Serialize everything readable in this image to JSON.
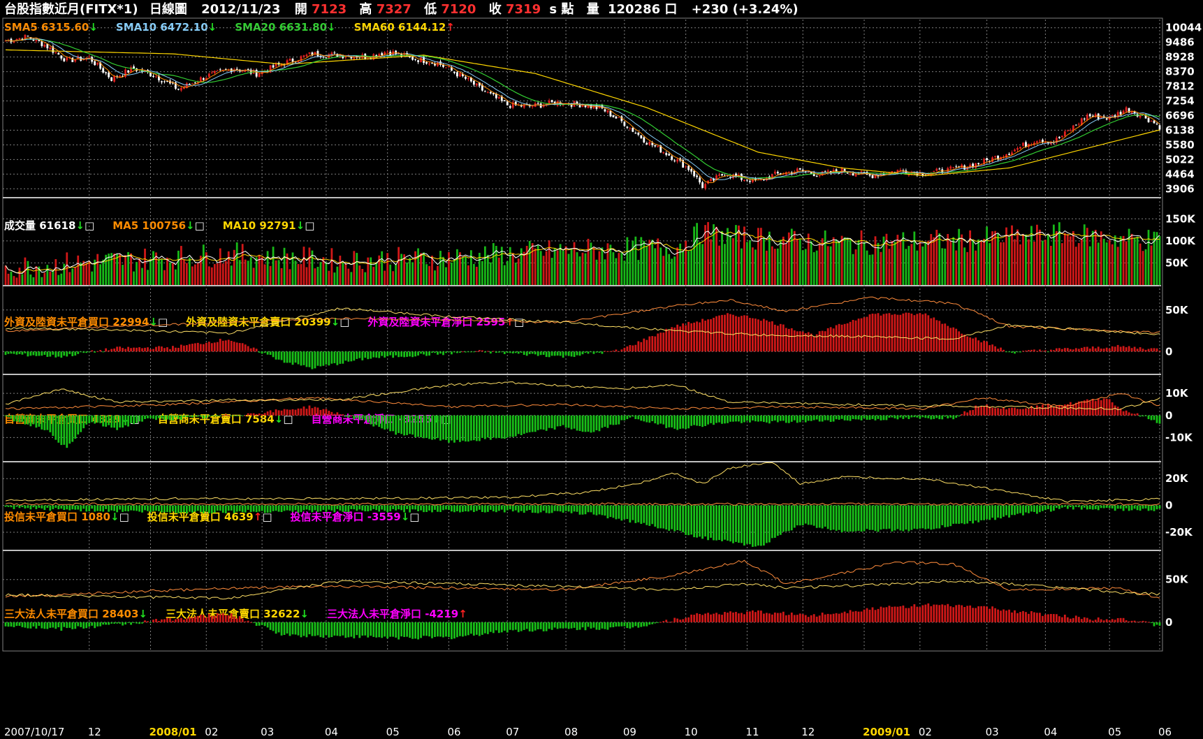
{
  "header": {
    "title": "台股指數近月(FITX*1)",
    "period": "日線圖",
    "date": "2012/11/23",
    "open_label": "開",
    "open": "7123",
    "high_label": "高",
    "high": "7327",
    "low_label": "低",
    "low": "7120",
    "close_label": "收",
    "close": "7319",
    "unit": "s 點",
    "volume_label": "量",
    "volume": "120286 口",
    "change": "+230 (+3.24%)"
  },
  "colors": {
    "up": "#e02020",
    "down": "#20c020",
    "grid": "#808080",
    "sma5": "#ff8c00",
    "sma10": "#87cefa",
    "sma20": "#32cd32",
    "sma60": "#ffd700",
    "magenta": "#ff00ff"
  },
  "chart_data": [
    {
      "type": "candlestick",
      "panel": "price",
      "legend": [
        {
          "label": "SMA5",
          "value": "6315.60",
          "arrow": "down",
          "color": "#ff8c00"
        },
        {
          "label": "SMA10",
          "value": "6472.10",
          "arrow": "down",
          "color": "#87cefa"
        },
        {
          "label": "SMA20",
          "value": "6631.80",
          "arrow": "down",
          "color": "#32cd32"
        },
        {
          "label": "SMA60",
          "value": "6144.12",
          "arrow": "up",
          "color": "#ffd700"
        }
      ],
      "ylim": [
        3700,
        10250
      ],
      "yticks": [
        "10044",
        "9486",
        "8928",
        "8370",
        "7812",
        "7254",
        "6696",
        "6138",
        "5580",
        "5022",
        "4464",
        "3906"
      ],
      "close_keypoints": [
        [
          0,
          9550
        ],
        [
          8,
          9700
        ],
        [
          14,
          9400
        ],
        [
          22,
          8800
        ],
        [
          30,
          8900
        ],
        [
          38,
          8100
        ],
        [
          46,
          8500
        ],
        [
          54,
          8200
        ],
        [
          62,
          7700
        ],
        [
          72,
          8200
        ],
        [
          82,
          8500
        ],
        [
          90,
          8300
        ],
        [
          100,
          8700
        ],
        [
          110,
          9050
        ],
        [
          120,
          9000
        ],
        [
          130,
          8950
        ],
        [
          137,
          9150
        ],
        [
          145,
          8900
        ],
        [
          155,
          8700
        ],
        [
          165,
          8100
        ],
        [
          172,
          7600
        ],
        [
          180,
          7100
        ],
        [
          188,
          7050
        ],
        [
          198,
          7200
        ],
        [
          208,
          7100
        ],
        [
          214,
          6950
        ],
        [
          222,
          6400
        ],
        [
          230,
          5700
        ],
        [
          238,
          5200
        ],
        [
          246,
          4600
        ],
        [
          250,
          4000
        ],
        [
          258,
          4500
        ],
        [
          264,
          4300
        ],
        [
          270,
          4200
        ],
        [
          276,
          4450
        ],
        [
          284,
          4600
        ],
        [
          292,
          4450
        ],
        [
          300,
          4600
        ],
        [
          310,
          4400
        ],
        [
          320,
          4600
        ],
        [
          330,
          4500
        ],
        [
          340,
          4650
        ],
        [
          350,
          4900
        ],
        [
          360,
          5300
        ],
        [
          370,
          5800
        ],
        [
          376,
          5700
        ],
        [
          380,
          6000
        ],
        [
          388,
          6700
        ],
        [
          396,
          6600
        ],
        [
          402,
          6950
        ],
        [
          408,
          6700
        ],
        [
          414,
          6280
        ]
      ],
      "sma60_keypoints": [
        [
          0,
          9200
        ],
        [
          60,
          9050
        ],
        [
          100,
          8650
        ],
        [
          150,
          9000
        ],
        [
          190,
          8300
        ],
        [
          230,
          7000
        ],
        [
          270,
          5300
        ],
        [
          300,
          4700
        ],
        [
          330,
          4400
        ],
        [
          360,
          4700
        ],
        [
          414,
          6150
        ]
      ],
      "xticks": [
        "2007/10/17",
        "12",
        "2008/01",
        "02",
        "03",
        "04",
        "05",
        "06",
        "07",
        "08",
        "09",
        "10",
        "11",
        "12",
        "2009/01",
        "02",
        "03",
        "04",
        "05",
        "06"
      ]
    },
    {
      "type": "bar",
      "panel": "volume",
      "legend": [
        {
          "label": "成交量",
          "value": "61618",
          "arrow": "down",
          "color": "#ffffff"
        },
        {
          "label": "MA5",
          "value": "100756",
          "arrow": "down",
          "color": "#ff8c00"
        },
        {
          "label": "MA10",
          "value": "92791",
          "arrow": "down",
          "color": "#ffd700"
        }
      ],
      "ylim": [
        0,
        190000
      ],
      "yticks": [
        "150K",
        "100K",
        "50K"
      ],
      "ytick_values": [
        150000,
        100000,
        50000
      ],
      "keypoints": [
        [
          0,
          40000
        ],
        [
          40,
          55000
        ],
        [
          80,
          70000
        ],
        [
          120,
          55000
        ],
        [
          160,
          62000
        ],
        [
          200,
          78000
        ],
        [
          240,
          85000
        ],
        [
          250,
          120000
        ],
        [
          260,
          110000
        ],
        [
          300,
          95000
        ],
        [
          340,
          100000
        ],
        [
          380,
          115000
        ],
        [
          414,
          100000
        ]
      ]
    },
    {
      "type": "bar+line",
      "panel": "foreign",
      "legend": [
        {
          "label": "外資及陸資未平倉買口",
          "value": "22994",
          "arrow": "down",
          "color": "#ff8c00"
        },
        {
          "label": "外資及陸資未平倉賣口",
          "value": "20399",
          "arrow": "down",
          "color": "#ffd700"
        },
        {
          "label": "外資及陸資未平倉淨口",
          "value": "2595",
          "arrow": "up",
          "color": "#ff00ff"
        }
      ],
      "ylim": [
        -25000,
        75000
      ],
      "yticks": [
        "50K",
        "0"
      ],
      "ytick_values": [
        50000,
        0
      ],
      "net_keypoints": [
        [
          0,
          -3000
        ],
        [
          20,
          -6000
        ],
        [
          40,
          4000
        ],
        [
          60,
          5000
        ],
        [
          80,
          15000
        ],
        [
          100,
          -12000
        ],
        [
          110,
          -20000
        ],
        [
          130,
          -8000
        ],
        [
          150,
          -4000
        ],
        [
          170,
          0
        ],
        [
          200,
          -6000
        ],
        [
          220,
          1000
        ],
        [
          240,
          30000
        ],
        [
          260,
          45000
        ],
        [
          270,
          40000
        ],
        [
          290,
          20000
        ],
        [
          310,
          45000
        ],
        [
          330,
          45000
        ],
        [
          345,
          20000
        ],
        [
          360,
          -1000
        ],
        [
          380,
          3000
        ],
        [
          400,
          6000
        ],
        [
          414,
          2595
        ]
      ],
      "buy_keypoints": [
        [
          0,
          25000
        ],
        [
          40,
          30000
        ],
        [
          80,
          35000
        ],
        [
          120,
          40000
        ],
        [
          160,
          38000
        ],
        [
          200,
          35000
        ],
        [
          240,
          55000
        ],
        [
          260,
          62000
        ],
        [
          280,
          48000
        ],
        [
          310,
          65000
        ],
        [
          340,
          58000
        ],
        [
          360,
          30000
        ],
        [
          414,
          23000
        ]
      ],
      "sell_keypoints": [
        [
          0,
          28000
        ],
        [
          40,
          26000
        ],
        [
          80,
          22000
        ],
        [
          120,
          52000
        ],
        [
          160,
          42000
        ],
        [
          200,
          35000
        ],
        [
          240,
          25000
        ],
        [
          270,
          20000
        ],
        [
          310,
          18000
        ],
        [
          340,
          15000
        ],
        [
          360,
          32000
        ],
        [
          414,
          20400
        ]
      ]
    },
    {
      "type": "bar+line",
      "panel": "dealer",
      "legend": [
        {
          "label": "自營商未平倉買口",
          "value": "4329",
          "arrow": "down",
          "color": "#ff8c00"
        },
        {
          "label": "自營商未平倉賣口",
          "value": "7584",
          "arrow": "down",
          "color": "#ffd700"
        },
        {
          "label": "自營商未平倉淨口",
          "value": "-3255",
          "arrow": "down",
          "color": "#ff00ff"
        }
      ],
      "ylim": [
        -20000,
        17000
      ],
      "yticks": [
        "10K",
        "0",
        "-10K"
      ],
      "ytick_values": [
        10000,
        0,
        -10000
      ],
      "net_keypoints": [
        [
          0,
          -1000
        ],
        [
          14,
          -6000
        ],
        [
          22,
          -15000
        ],
        [
          30,
          -3000
        ],
        [
          40,
          -6000
        ],
        [
          50,
          -2000
        ],
        [
          70,
          -1000
        ],
        [
          90,
          1000
        ],
        [
          110,
          4000
        ],
        [
          125,
          -1000
        ],
        [
          140,
          -8000
        ],
        [
          160,
          -12000
        ],
        [
          180,
          -10000
        ],
        [
          200,
          -5000
        ],
        [
          210,
          -8000
        ],
        [
          225,
          -1000
        ],
        [
          240,
          -6000
        ],
        [
          260,
          -3000
        ],
        [
          280,
          -3000
        ],
        [
          300,
          -2000
        ],
        [
          340,
          -1000
        ],
        [
          350,
          5000
        ],
        [
          360,
          3000
        ],
        [
          380,
          5000
        ],
        [
          395,
          8000
        ],
        [
          400,
          3000
        ],
        [
          414,
          -3255
        ]
      ],
      "buy_keypoints": [
        [
          0,
          3000
        ],
        [
          60,
          5000
        ],
        [
          110,
          8000
        ],
        [
          160,
          4000
        ],
        [
          200,
          5000
        ],
        [
          240,
          3000
        ],
        [
          280,
          4000
        ],
        [
          330,
          3000
        ],
        [
          350,
          8000
        ],
        [
          380,
          4000
        ],
        [
          400,
          10000
        ],
        [
          414,
          4300
        ]
      ],
      "sell_keypoints": [
        [
          0,
          5000
        ],
        [
          20,
          12000
        ],
        [
          40,
          6000
        ],
        [
          80,
          7000
        ],
        [
          120,
          7000
        ],
        [
          160,
          14000
        ],
        [
          180,
          15000
        ],
        [
          220,
          12000
        ],
        [
          240,
          14000
        ],
        [
          260,
          6000
        ],
        [
          300,
          5000
        ],
        [
          350,
          4000
        ],
        [
          400,
          3000
        ],
        [
          414,
          7600
        ]
      ]
    },
    {
      "type": "bar+line",
      "panel": "trust",
      "legend": [
        {
          "label": "投信未平倉買口",
          "value": "1080",
          "arrow": "down",
          "color": "#ff8c00"
        },
        {
          "label": "投信未平倉賣口",
          "value": "4639",
          "arrow": "up",
          "color": "#ffd700"
        },
        {
          "label": "投信未平倉淨口",
          "value": "-3559",
          "arrow": "down",
          "color": "#ff00ff"
        }
      ],
      "ylim": [
        -32000,
        30000
      ],
      "yticks": [
        "20K",
        "0",
        "-20K"
      ],
      "ytick_values": [
        20000,
        0,
        -20000
      ],
      "net_keypoints": [
        [
          0,
          -2000
        ],
        [
          60,
          -5000
        ],
        [
          120,
          -4000
        ],
        [
          180,
          -4000
        ],
        [
          210,
          -6000
        ],
        [
          230,
          -14000
        ],
        [
          250,
          -24000
        ],
        [
          270,
          -31000
        ],
        [
          285,
          -14000
        ],
        [
          300,
          -19000
        ],
        [
          330,
          -18000
        ],
        [
          360,
          -8000
        ],
        [
          380,
          -2000
        ],
        [
          414,
          -3559
        ]
      ],
      "buy_keypoints": [
        [
          0,
          1000
        ],
        [
          414,
          1080
        ]
      ],
      "sell_keypoints": [
        [
          0,
          4000
        ],
        [
          60,
          5000
        ],
        [
          120,
          5000
        ],
        [
          180,
          6000
        ],
        [
          210,
          10000
        ],
        [
          230,
          18000
        ],
        [
          240,
          24000
        ],
        [
          250,
          16000
        ],
        [
          260,
          28000
        ],
        [
          275,
          32000
        ],
        [
          285,
          16000
        ],
        [
          300,
          21000
        ],
        [
          330,
          20000
        ],
        [
          360,
          10000
        ],
        [
          380,
          3000
        ],
        [
          414,
          4639
        ]
      ]
    },
    {
      "type": "bar+line",
      "panel": "institutional",
      "legend": [
        {
          "label": "三大法人未平倉買口",
          "value": "28403",
          "arrow": "down",
          "color": "#ff8c00"
        },
        {
          "label": "三大法人未平倉賣口",
          "value": "32622",
          "arrow": "down",
          "color": "#ffd700"
        },
        {
          "label": "三大法人未平倉淨口",
          "value": "-4219",
          "arrow": "up",
          "color": "#ff00ff"
        }
      ],
      "ylim": [
        -32000,
        80000
      ],
      "yticks": [
        "50K",
        "0"
      ],
      "ytick_values": [
        50000,
        0
      ],
      "net_keypoints": [
        [
          0,
          -3000
        ],
        [
          20,
          -8000
        ],
        [
          40,
          -3000
        ],
        [
          60,
          4000
        ],
        [
          80,
          10000
        ],
        [
          100,
          -15000
        ],
        [
          140,
          -18000
        ],
        [
          160,
          -18000
        ],
        [
          180,
          -10000
        ],
        [
          200,
          -8000
        ],
        [
          225,
          -6000
        ],
        [
          250,
          10000
        ],
        [
          270,
          12000
        ],
        [
          290,
          8000
        ],
        [
          310,
          16000
        ],
        [
          330,
          20000
        ],
        [
          350,
          18000
        ],
        [
          370,
          10000
        ],
        [
          390,
          4000
        ],
        [
          400,
          5000
        ],
        [
          414,
          -4219
        ]
      ],
      "buy_keypoints": [
        [
          0,
          30000
        ],
        [
          40,
          35000
        ],
        [
          80,
          40000
        ],
        [
          120,
          42000
        ],
        [
          160,
          40000
        ],
        [
          200,
          38000
        ],
        [
          240,
          55000
        ],
        [
          265,
          72000
        ],
        [
          280,
          45000
        ],
        [
          320,
          70000
        ],
        [
          340,
          68000
        ],
        [
          360,
          38000
        ],
        [
          400,
          40000
        ],
        [
          414,
          28400
        ]
      ],
      "sell_keypoints": [
        [
          0,
          32000
        ],
        [
          40,
          30000
        ],
        [
          80,
          28000
        ],
        [
          120,
          48000
        ],
        [
          160,
          45000
        ],
        [
          200,
          42000
        ],
        [
          240,
          38000
        ],
        [
          265,
          45000
        ],
        [
          280,
          40000
        ],
        [
          320,
          45000
        ],
        [
          340,
          48000
        ],
        [
          360,
          45000
        ],
        [
          400,
          35000
        ],
        [
          414,
          32600
        ]
      ]
    }
  ]
}
